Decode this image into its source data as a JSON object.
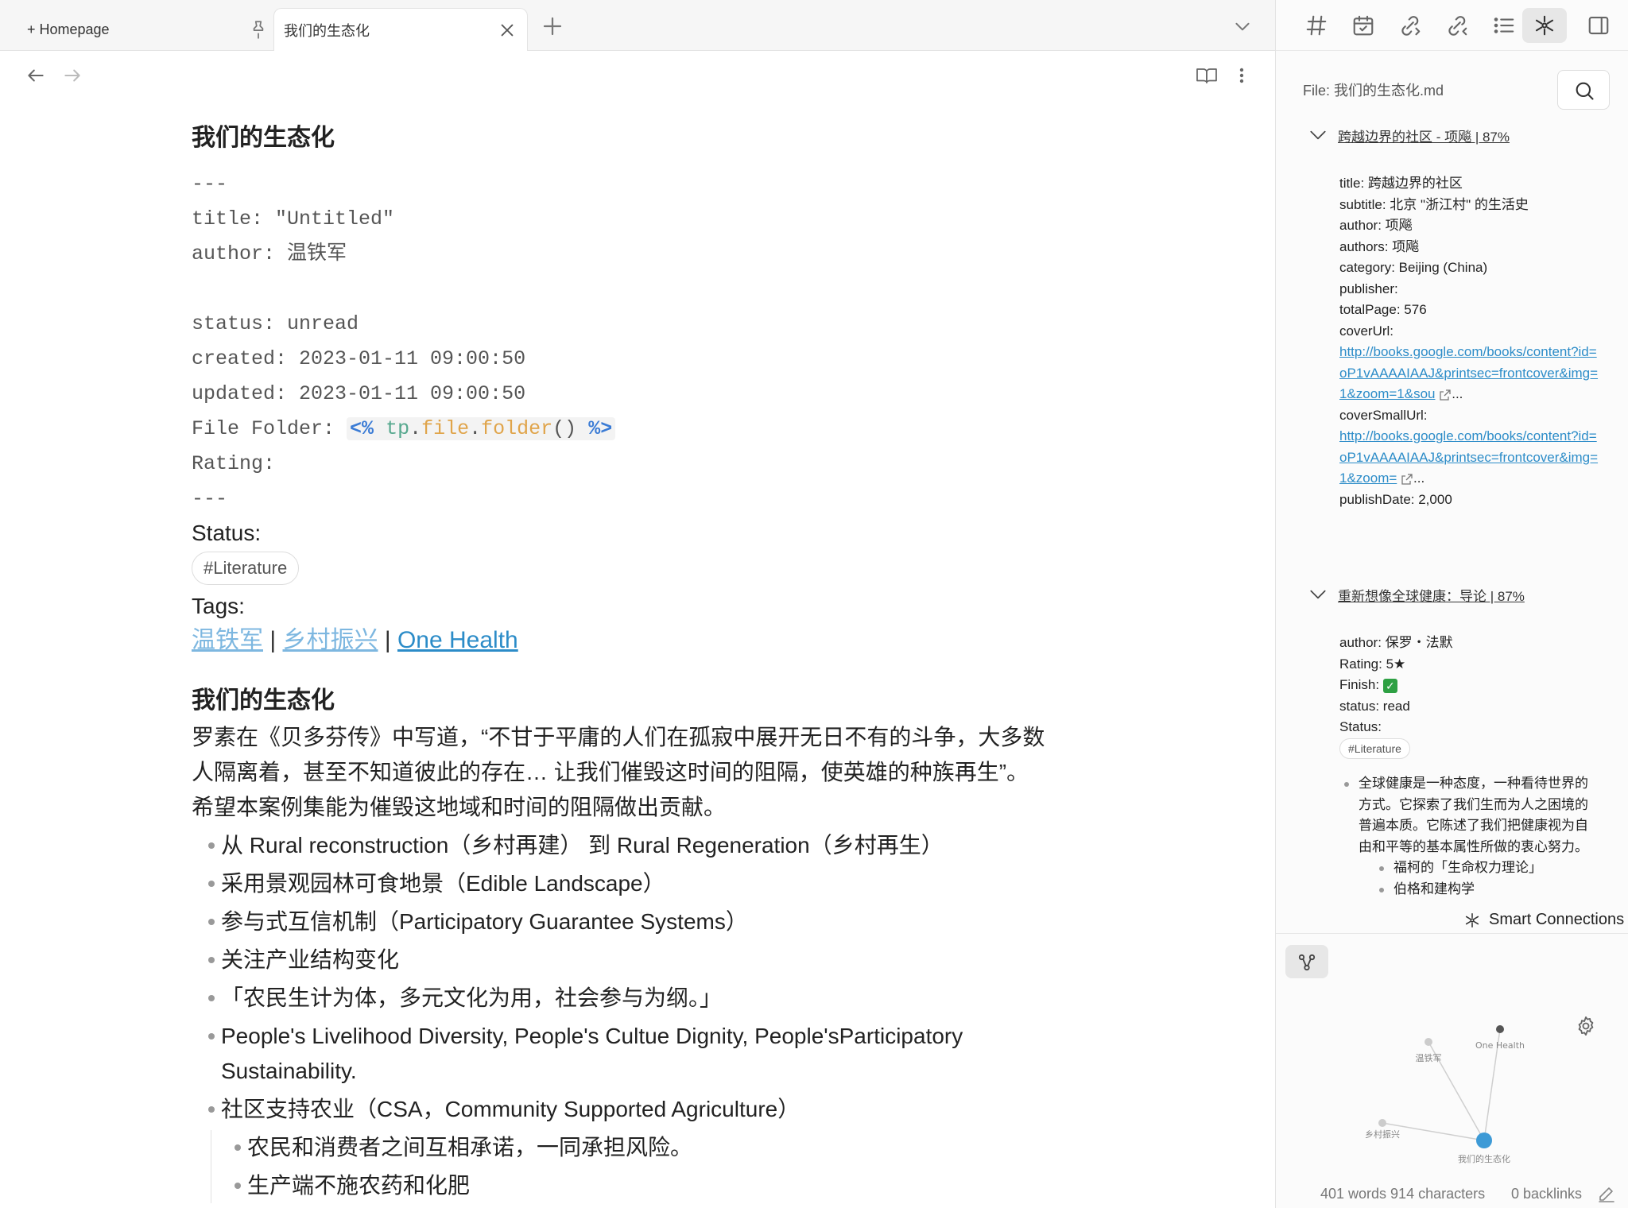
{
  "tabs": {
    "home_label": "+ Homepage",
    "active_label": "我们的生态化"
  },
  "note": {
    "title": "我们的生态化",
    "frontmatter": {
      "dash_open": "---",
      "title_line": "title: \"Untitled\"",
      "author_line": "author: 温铁军",
      "status_line": "status: unread",
      "created_line": "created: 2023-01-11 09:00:50",
      "updated_line": "updated: 2023-01-11 09:00:50",
      "folder_key": "File Folder: ",
      "folder_code": {
        "open": "<%",
        "obj": "tp",
        "dot1": ".",
        "prop": "file",
        "dot2": ".",
        "fn": "folder",
        "parens": "()",
        "close": "%>"
      },
      "rating_line": "Rating:",
      "dash_close": "---"
    },
    "status_label": "Status:",
    "status_tag": "#Literature",
    "tags_label": "Tags:",
    "tag_links": [
      "温铁军",
      "乡村振兴",
      "One Health"
    ],
    "tag_sep": "|",
    "section_heading": "我们的生态化",
    "paragraph_lines": [
      "罗素在《贝多芬传》中写道，“不甘于平庸的人们在孤寂中展开无日不有的斗争，大多数",
      "人隔离着，甚至不知道彼此的存在… 让我们催毁这时间的阻隔，使英雄的种族再生”。",
      "希望本案例集能为催毁这地域和时间的阻隔做出贡献。"
    ],
    "bullets": [
      "从 Rural reconstruction（乡村再建） 到 Rural Regeneration（乡村再生）",
      "采用景观园林可食地景（Edible Landscape）",
      "参与式互信机制（Participatory Guarantee Systems）",
      "关注产业结构变化",
      "「农民生计为体，多元文化为用，社会参与为纲。」",
      "People's Livelihood Diversity, People's Cultue Dignity, People'sParticipatory Sustainability.",
      "社区支持农业（CSA，Community Supported Agriculture）"
    ],
    "sub_bullets": [
      "农民和消费者之间互相承诺，一同承担风险。",
      "生产端不施农药和化肥"
    ]
  },
  "sidebar": {
    "file_label": "File: 我们的生态化.md",
    "result1": {
      "heading": "跨越边界的社区 - 项飚 | 87%",
      "lines": [
        "title: 跨越边界的社区",
        "subtitle: 北京 \"浙江村\" 的生活史",
        "author: 项飚",
        "authors: 项飚",
        "category: Beijing (China)",
        "publisher:",
        "totalPage: 576",
        "coverUrl:"
      ],
      "cover_url": "http://books.google.com/books/content?id=oP1vAAAAIAAJ&printsec=frontcover&img=1&zoom=1&sou",
      "cover_small_label": "coverSmallUrl:",
      "cover_small_url": "http://books.google.com/books/content?id=oP1vAAAAIAAJ&printsec=frontcover&img=1&zoom=",
      "ellipsis": "...",
      "publish_date": "publishDate: 2,000"
    },
    "result2": {
      "heading": "重新想像全球健康：导论 | 87%",
      "author": "author: 保罗・法默",
      "rating": "Rating: 5★",
      "finish": "Finish:",
      "finish_check": "✓",
      "status": "status: read",
      "status_label": "Status:",
      "tag": "#Literature",
      "bullet": "全球健康是一种态度，一种看待世界的方式。它探索了我们生而为人之困境的普遍本质。它陈述了我们把健康视为自由和平等的基本属性所做的衷心努力。",
      "sub1": "福柯的「生命权力理论」",
      "sub2": "伯格和建构学"
    },
    "smart_connections_label": "Smart Connections",
    "graph": {
      "nodes": [
        {
          "label": "温铁军",
          "color": "#cccccc"
        },
        {
          "label": "One Health",
          "color": "#555555"
        },
        {
          "label": "乡村振兴",
          "color": "#cccccc"
        },
        {
          "label": "我们的生态化",
          "color": "#3d9ad6"
        }
      ]
    },
    "status_words": "401 words 914 characters",
    "status_backlinks": "0 backlinks"
  }
}
